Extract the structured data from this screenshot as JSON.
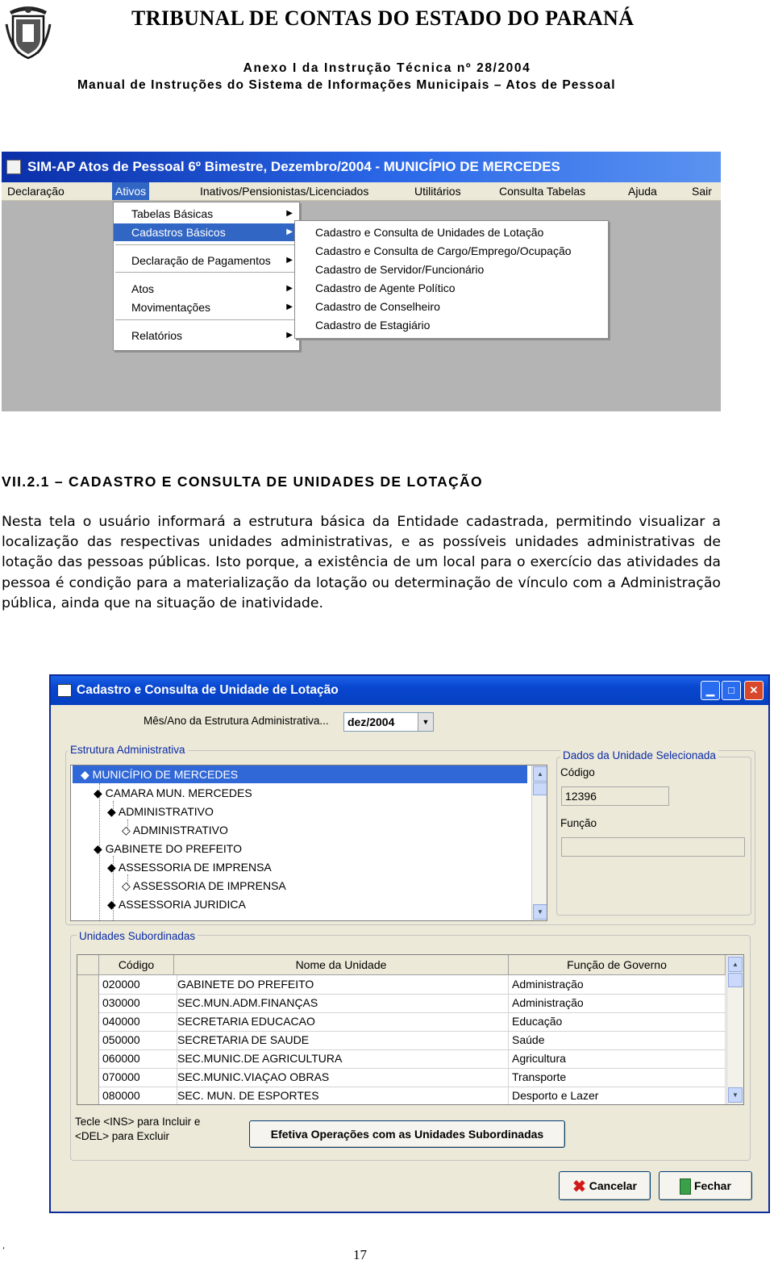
{
  "header": {
    "title": "TRIBUNAL DE CONTAS DO ESTADO DO PARANÁ",
    "subtitle1": "Anexo I da Instrução Técnica nº 28/2004",
    "subtitle2": "Manual de Instruções do Sistema de Informações Municipais – Atos de Pessoal"
  },
  "app_window": {
    "title": "SIM-AP Atos de Pessoal  6º Bimestre, Dezembro/2004 - MUNICÍPIO DE MERCEDES",
    "menubar": [
      "Declaração",
      "Ativos",
      "Inativos/Pensionistas/Licenciados",
      "Utilitários",
      "Consulta Tabelas",
      "Ajuda",
      "Sair"
    ],
    "active_menu": "Ativos",
    "submenu": [
      "Tabelas Básicas",
      "Cadastros Básicos",
      "Declaração de Pagamentos",
      "Atos",
      "Movimentações",
      "Relatórios"
    ],
    "submenu_selected": "Cadastros Básicos",
    "cascade_menu": [
      "Cadastro e Consulta de Unidades de Lotação",
      "Cadastro e Consulta de Cargo/Emprego/Ocupação",
      "Cadastro de Servidor/Funcionário",
      "Cadastro de Agente Político",
      "Cadastro de Conselheiro",
      "Cadastro de Estagiário"
    ]
  },
  "section": {
    "title": "VII.2.1 – CADASTRO E CONSULTA DE UNIDADES DE LOTAÇÃO",
    "paragraph": "Nesta tela o usuário informará a estrutura básica da Entidade cadastrada, permitindo visualizar a localização das respectivas unidades administrativas, e as possíveis unidades administrativas de lotação das pessoas públicas. Isto porque, a existência de um local para o exercício das atividades da pessoa é condição para a materialização da lotação ou determinação de vínculo com a Administração pública, ainda que na situação de inatividade."
  },
  "dialog": {
    "title": "Cadastro e Consulta de Unidade de Lotação",
    "period_label": "Mês/Ano da Estrutura Administrativa...",
    "period_value": "dez/2004",
    "tree_label": "Estrutura Administrativa",
    "tree": [
      {
        "text": "MUNICÍPIO DE MERCEDES",
        "marker": "◆"
      },
      {
        "text": "CAMARA MUN. MERCEDES",
        "marker": "◆"
      },
      {
        "text": "ADMINISTRATIVO",
        "marker": "◆"
      },
      {
        "text": "ADMINISTRATIVO",
        "marker": "◇"
      },
      {
        "text": "GABINETE DO PREFEITO",
        "marker": "◆"
      },
      {
        "text": "ASSESSORIA DE IMPRENSA",
        "marker": "◆"
      },
      {
        "text": "ASSESSORIA DE IMPRENSA",
        "marker": "◇"
      },
      {
        "text": "ASSESSORIA JURIDICA",
        "marker": "◆"
      }
    ],
    "selected_unit_label": "Dados da Unidade Selecionada",
    "codigo_label": "Código",
    "codigo_value": "12396",
    "funcao_label": "Função",
    "funcao_value": "",
    "sub_units_label": "Unidades Subordinadas",
    "grid_headers": [
      "Código",
      "Nome da Unidade",
      "Função de Governo"
    ],
    "grid_rows": [
      [
        "020000",
        "GABINETE DO PREFEITO",
        "Administração"
      ],
      [
        "030000",
        "SEC.MUN.ADM.FINANÇAS",
        "Administração"
      ],
      [
        "040000",
        "SECRETARIA EDUCACAO",
        "Educação"
      ],
      [
        "050000",
        "SECRETARIA DE SAUDE",
        "Saúde"
      ],
      [
        "060000",
        "SEC.MUNIC.DE AGRICULTURA",
        "Agricultura"
      ],
      [
        "070000",
        "SEC.MUNIC.VIAÇAO OBRAS",
        "Transporte"
      ],
      [
        "080000",
        "SEC. MUN. DE ESPORTES",
        "Desporto e Lazer"
      ]
    ],
    "hint_line1": "Tecle <INS> para Incluir e",
    "hint_line2": "<DEL> para Excluir",
    "apply_button": "Efetiva Operações com as Unidades Subordinadas",
    "cancel_button": "Cancelar",
    "close_button": "Fechar"
  },
  "footer": {
    "mark": "‘",
    "page_number": "17"
  }
}
